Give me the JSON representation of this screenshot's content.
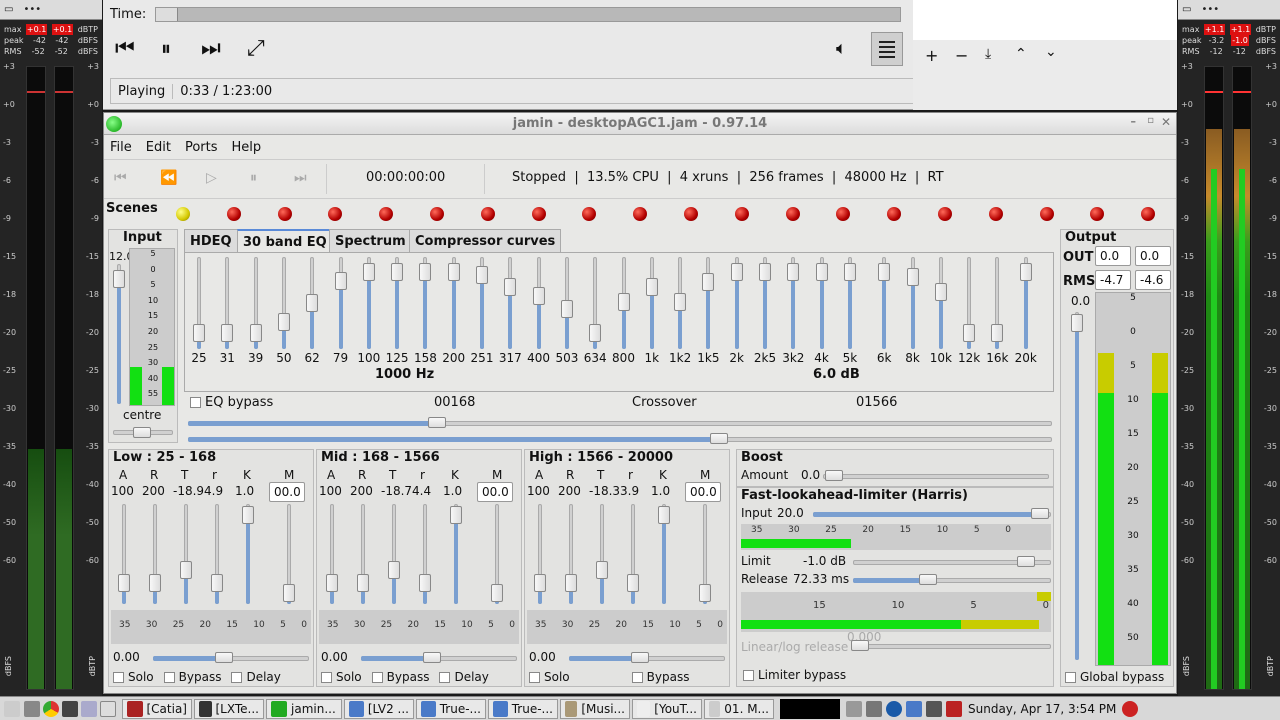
{
  "left_meter": {
    "labels": {
      "max": "max",
      "peak": "peak",
      "rms": "RMS",
      "max_l": "+0.1",
      "max_r": "+0.1",
      "unit1": "dBTP",
      "peak_l": "-42",
      "peak_r": "-42",
      "unit2": "dBFS",
      "rms_l": "-52",
      "rms_r": "-52",
      "unit3": "dBFS"
    },
    "scale": [
      "+3",
      "+0",
      "-3",
      "-6",
      "-9",
      "-15",
      "-18",
      "-20",
      "-25",
      "-30",
      "-35",
      "-40",
      "-50",
      "-60"
    ],
    "bottom_left": "dBFS",
    "bottom_right": "dBTP"
  },
  "right_meter": {
    "labels": {
      "max": "max",
      "peak": "peak",
      "rms": "RMS",
      "max_l": "+1.1",
      "max_r": "+1.1",
      "unit1": "dBTP",
      "peak_l": "-3.2",
      "peak_r": "-1.0",
      "unit2": "dBFS",
      "rms_l": "-12",
      "rms_r": "-12",
      "unit3": "dBFS"
    },
    "scale": [
      "+3",
      "+0",
      "-3",
      "-6",
      "-9",
      "-15",
      "-18",
      "-20",
      "-25",
      "-30",
      "-35",
      "-40",
      "-50",
      "-60"
    ],
    "bottom_left": "dBFS",
    "bottom_right": "dBTP"
  },
  "player": {
    "time_label": "Time:",
    "status": "Playing",
    "position": "0:33 / 1:23:00",
    "progress": 0.007
  },
  "jamin": {
    "title": "jamin - desktopAGC1.jam - 0.97.14",
    "menu": [
      "File",
      "Edit",
      "Ports",
      "Help"
    ],
    "transport_time": "00:00:00:00",
    "status": "Stopped  |  13.5% CPU  |  4 xruns  |  256 frames  |  48000 Hz  |  RT",
    "scenes_label": "Scenes",
    "input_label": "Input",
    "input_value": "12.0",
    "input_scale": [
      "5",
      "0",
      "5",
      "10",
      "15",
      "20",
      "25",
      "30",
      "40",
      "55"
    ],
    "input_centre": "centre",
    "tabs": [
      "HDEQ",
      "30 band EQ",
      "Spectrum",
      "Compressor curves"
    ],
    "eq_freqs": [
      "25",
      "31",
      "39",
      "50",
      "62",
      "79",
      "100",
      "125",
      "158",
      "200",
      "251",
      "317",
      "400",
      "503",
      "634",
      "800",
      "1k",
      "1k2",
      "1k5",
      "2k",
      "2k5",
      "3k2",
      "4k",
      "5k",
      "6k",
      "8k",
      "10k",
      "12k",
      "16k",
      "20k"
    ],
    "eq_levels": [
      0.1,
      0.1,
      0.1,
      0.25,
      0.5,
      0.8,
      0.92,
      0.92,
      0.92,
      0.92,
      0.88,
      0.72,
      0.6,
      0.42,
      0.1,
      0.52,
      0.72,
      0.52,
      0.78,
      0.92,
      0.92,
      0.92,
      0.92,
      0.92,
      0.92,
      0.85,
      0.65,
      0.1,
      0.1,
      0.92
    ],
    "eq_freq_readout": "1000 Hz",
    "eq_gain_readout": "6.0 dB",
    "eq_bypass": "EQ bypass",
    "xover_low": "00168",
    "xover_label": "Crossover",
    "xover_high": "01566",
    "bands": [
      {
        "title": "Low : 25 - 168",
        "params": [
          "A",
          "R",
          "T",
          "r",
          "K",
          "M"
        ],
        "values": [
          "100",
          "200",
          "-18.9",
          "4.9",
          "1.0"
        ],
        "m": "00.0",
        "gain": "0.00",
        "checks": [
          "Solo",
          "Bypass",
          "Delay"
        ]
      },
      {
        "title": "Mid : 168 - 1566",
        "params": [
          "A",
          "R",
          "T",
          "r",
          "K",
          "M"
        ],
        "values": [
          "100",
          "200",
          "-18.7",
          "4.4",
          "1.0"
        ],
        "m": "00.0",
        "gain": "0.00",
        "checks": [
          "Solo",
          "Bypass",
          "Delay"
        ]
      },
      {
        "title": "High : 1566 - 20000",
        "params": [
          "A",
          "R",
          "T",
          "r",
          "K",
          "M"
        ],
        "values": [
          "100",
          "200",
          "-18.3",
          "3.9",
          "1.0"
        ],
        "m": "00.0",
        "gain": "0.00",
        "checks": [
          "Solo",
          "Bypass"
        ]
      }
    ],
    "band_ticks": [
      "35",
      "30",
      "25",
      "20",
      "15",
      "10",
      "5",
      "0"
    ],
    "boost_label": "Boost",
    "amount_label": "Amount",
    "amount_value": "0.0",
    "limiter_title": "Fast-lookahead-limiter (Harris)",
    "lim_input_label": "Input",
    "lim_input_value": "20.0",
    "lim_ticks": [
      "35",
      "30",
      "25",
      "20",
      "15",
      "10",
      "5",
      "0"
    ],
    "limit_label": "Limit",
    "limit_value": "-1.0 dB",
    "release_label": "Release",
    "release_value": "72.33 ms",
    "lim_meter_ticks": [
      "15",
      "10",
      "5",
      "0"
    ],
    "linlog_label": "Linear/log release",
    "linlog_value": "0.000",
    "limiter_bypass": "Limiter bypass",
    "output_label": "Output",
    "out_label": "OUT",
    "out_l": "0.0",
    "out_r": "0.0",
    "rms_label": "RMS",
    "rms_l": "-4.7",
    "rms_r": "-4.6",
    "out_gain": "0.0",
    "out_scale": [
      "5",
      "0",
      "5",
      "10",
      "15",
      "20",
      "25",
      "30",
      "35",
      "40",
      "50"
    ],
    "global_bypass": "Global bypass"
  },
  "taskbar": {
    "items": [
      "[Catia]",
      "[LXTe...",
      "jamin...",
      "[LV2 ...",
      "True-...",
      "True-...",
      "[Musi...",
      "[YouT...",
      "01. M..."
    ],
    "clock": "Sunday, Apr 17, 3:54 PM"
  }
}
